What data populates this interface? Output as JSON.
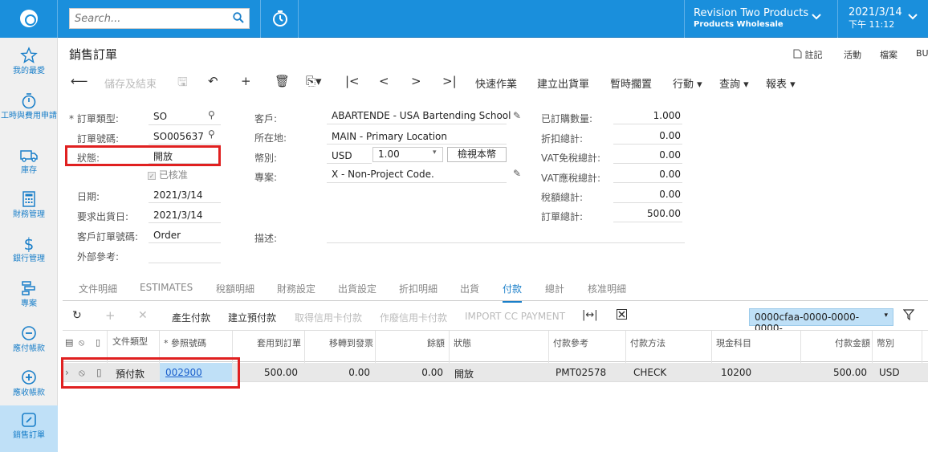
{
  "topbar": {
    "search_placeholder": "Search...",
    "tenant_name": "Revision Two Products",
    "tenant_sub": "Products Wholesale",
    "date": "2021/3/14",
    "time": "下午 11:12"
  },
  "sidebar": {
    "items": [
      {
        "label": "我的最愛",
        "icon": "star-icon"
      },
      {
        "label": "工時與費用申請",
        "icon": "stopwatch-icon"
      },
      {
        "label": "庫存",
        "icon": "truck-icon"
      },
      {
        "label": "財務管理",
        "icon": "calculator-icon"
      },
      {
        "label": "銀行管理",
        "icon": "dollar-icon"
      },
      {
        "label": "專案",
        "icon": "gantt-icon"
      },
      {
        "label": "應付帳款",
        "icon": "minus-circle-icon"
      },
      {
        "label": "應收帳款",
        "icon": "plus-circle-icon"
      },
      {
        "label": "銷售訂單",
        "icon": "edit-icon"
      }
    ]
  },
  "page": {
    "title": "銷售訂單",
    "links": {
      "notes": "註記",
      "activities": "活動",
      "files": "檔案",
      "bu": "BU"
    }
  },
  "toolbar": {
    "save_close": "儲存及結束",
    "quick": "快速作業",
    "create_shipment": "建立出貨單",
    "hold": "暫時擱置",
    "actions": "行動",
    "inquiries": "查詢",
    "reports": "報表"
  },
  "form": {
    "order_type_label": "* 訂單類型:",
    "order_type": "SO",
    "order_nbr_label": "訂單號碼:",
    "order_nbr": "SO005637",
    "status_label": "狀態:",
    "status": "開放",
    "approved": "已核准",
    "date_label": "日期:",
    "date": "2021/3/14",
    "req_date_label": "要求出貨日:",
    "req_date": "2021/3/14",
    "cust_order_label": "客戶訂單號碼:",
    "cust_order": "Order",
    "ext_ref_label": "外部參考:",
    "customer_label": "客戶:",
    "customer": "ABARTENDE - USA Bartending School",
    "location_label": "所在地:",
    "location": "MAIN - Primary Location",
    "currency_label": "幣別:",
    "currency": "USD",
    "rate": "1.00",
    "view_base": "檢視本幣",
    "project_label": "專案:",
    "project": "X - Non-Project Code.",
    "desc_label": "描述:",
    "ordered_qty_label": "已訂購數量:",
    "ordered_qty": "1.000",
    "discount_label": "折扣總計:",
    "discount": "0.00",
    "vat_exempt_label": "VAT免稅總計:",
    "vat_exempt": "0.00",
    "vat_taxable_label": "VAT應稅總計:",
    "vat_taxable": "0.00",
    "tax_total_label": "稅額總計:",
    "tax_total": "0.00",
    "order_total_label": "訂單總計:",
    "order_total": "500.00"
  },
  "tabs": [
    "文件明細",
    "ESTIMATES",
    "稅額明細",
    "財務設定",
    "出貨設定",
    "折扣明細",
    "出貨",
    "付款",
    "總計",
    "核准明細"
  ],
  "grid_toolbar": {
    "create_payment": "產生付款",
    "create_prepayment": "建立預付款",
    "capture_cc": "取得信用卡付款",
    "void_cc": "作廢信用卡付款",
    "import_cc": "IMPORT CC PAYMENT",
    "dropdown": "0000cfaa-0000-0000-0000-..."
  },
  "grid": {
    "headers": [
      "文件類型",
      "* 參照號碼",
      "套用到訂單",
      "移轉到發票",
      "餘額",
      "狀態",
      "付款參考",
      "付款方法",
      "現金科目",
      "付款金額",
      "幣別"
    ],
    "row": {
      "doc_type": "預付款",
      "ref_nbr": "002900",
      "applied": "500.00",
      "transferred": "0.00",
      "balance": "0.00",
      "status": "開放",
      "payment_ref": "PMT02578",
      "method": "CHECK",
      "cash_account": "10200",
      "amount": "500.00",
      "currency": "USD"
    }
  }
}
